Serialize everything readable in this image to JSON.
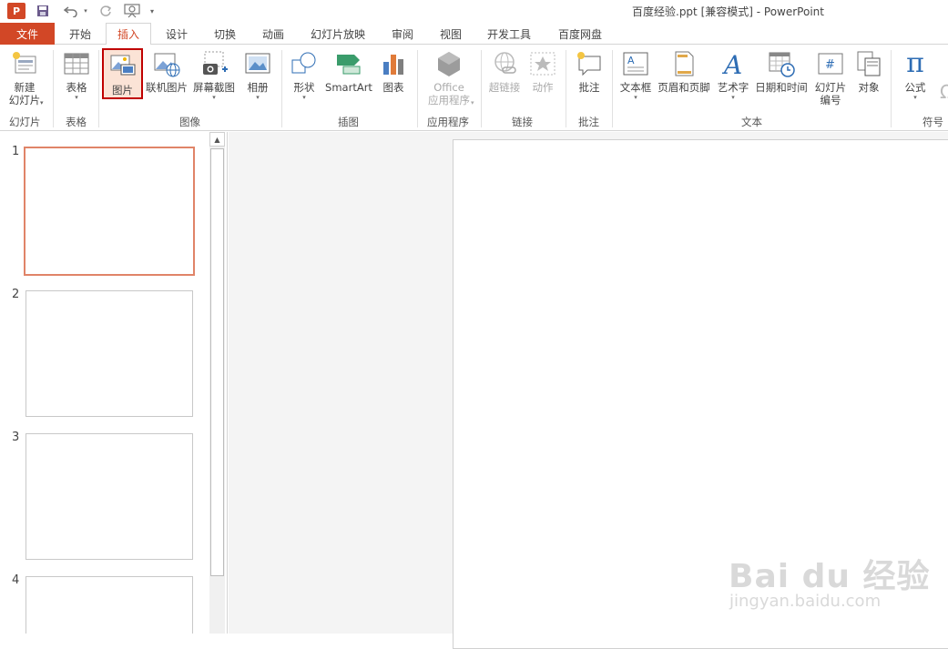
{
  "window": {
    "title": "百度经验.ppt [兼容模式] - PowerPoint",
    "app_badge": "P"
  },
  "qat": {
    "save_icon": "save-icon",
    "undo_icon": "undo-icon",
    "redo_icon": "redo-icon",
    "slideshow_icon": "slideshow-from-start-icon",
    "customize_icon": "customize-qat-icon"
  },
  "tabs": {
    "file": "文件",
    "items": [
      "开始",
      "插入",
      "设计",
      "切换",
      "动画",
      "幻灯片放映",
      "审阅",
      "视图",
      "开发工具",
      "百度网盘"
    ],
    "active": "插入"
  },
  "ribbon": {
    "groups": {
      "slides": "幻灯片",
      "tables": "表格",
      "images": "图像",
      "illustrations": "插图",
      "apps": "应用程序",
      "links": "链接",
      "comments": "批注",
      "text": "文本",
      "symbols": "符号"
    },
    "buttons": {
      "new_slide_1": "新建",
      "new_slide_2": "幻灯片",
      "table": "表格",
      "picture": "图片",
      "online_pictures": "联机图片",
      "screenshot": "屏幕截图",
      "photo_album": "相册",
      "shapes": "形状",
      "smartart": "SmartArt",
      "chart": "图表",
      "office_apps_1": "Office",
      "office_apps_2": "应用程序",
      "hyperlink": "超链接",
      "action": "动作",
      "comment": "批注",
      "textbox": "文本框",
      "header_footer": "页眉和页脚",
      "wordart": "艺术字",
      "datetime": "日期和时间",
      "slide_number_1": "幻灯片",
      "slide_number_2": "编号",
      "object": "对象",
      "equation": "公式",
      "equation_glyph": "π"
    }
  },
  "slides": {
    "numbers": [
      "1",
      "2",
      "3",
      "4"
    ]
  },
  "watermark": {
    "text": "Bai du 经验",
    "url": "jingyan.baidu.com"
  },
  "colors": {
    "accent": "#d24726",
    "selection": "#c00000"
  }
}
